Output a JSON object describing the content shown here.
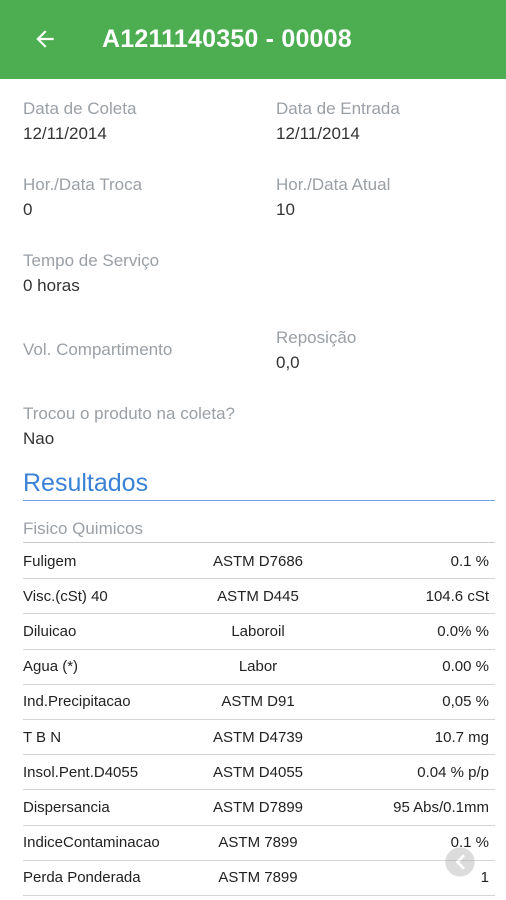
{
  "header": {
    "title": "A1211140350 - 00008"
  },
  "fields": {
    "data_coleta": {
      "label": "Data de Coleta",
      "value": "12/11/2014"
    },
    "data_entrada": {
      "label": "Data de Entrada",
      "value": "12/11/2014"
    },
    "hor_troca": {
      "label": "Hor./Data Troca",
      "value": "0"
    },
    "hor_atual": {
      "label": "Hor./Data Atual",
      "value": "10"
    },
    "tempo_servico": {
      "label": "Tempo de Serviço",
      "value": "0 horas"
    },
    "vol_compartimento": {
      "label": "Vol. Compartimento",
      "value": ""
    },
    "reposicao": {
      "label": "Reposição",
      "value": "0,0"
    },
    "trocou_produto": {
      "label": "Trocou o produto na coleta?",
      "value": "Nao"
    }
  },
  "results": {
    "title": "Resultados",
    "subsection": "Fisico Quimicos",
    "rows": [
      {
        "name": "Fuligem",
        "method": "ASTM D7686",
        "value": "0.1 %"
      },
      {
        "name": "Visc.(cSt) 40",
        "method": "ASTM D445",
        "value": "104.6 cSt"
      },
      {
        "name": "Diluicao",
        "method": "Laboroil",
        "value": "0.0% %"
      },
      {
        "name": "Agua (*)",
        "method": "Labor",
        "value": "0.00 %"
      },
      {
        "name": "Ind.Precipitacao",
        "method": "ASTM D91",
        "value": "0,05 %"
      },
      {
        "name": "T B N",
        "method": "ASTM D4739",
        "value": "10.7 mg"
      },
      {
        "name": "Insol.Pent.D4055",
        "method": "ASTM D4055",
        "value": "0.04 % p/p"
      },
      {
        "name": "Dispersancia",
        "method": "ASTM D7899",
        "value": "95 Abs/0.1mm"
      },
      {
        "name": "IndiceContaminacao",
        "method": "ASTM 7899",
        "value": "0.1 %"
      },
      {
        "name": "Perda Ponderada",
        "method": "ASTM 7899",
        "value": "1"
      }
    ]
  },
  "colors": {
    "appbar": "#4cae50",
    "accent": "#3b82d6",
    "label": "#9aa0a6"
  },
  "icons": {
    "back": "arrow-back-icon",
    "floating": "share-icon"
  }
}
